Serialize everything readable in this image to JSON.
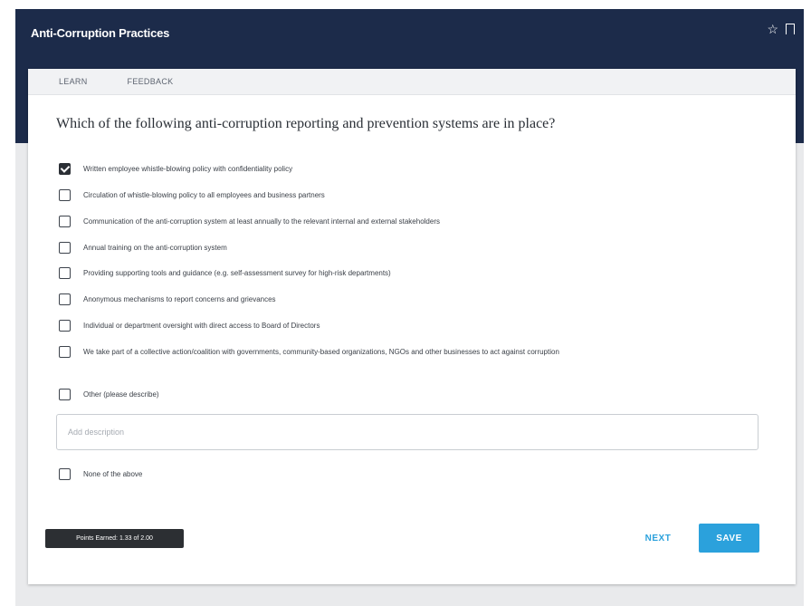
{
  "window": {
    "title": "Anti-Corruption Practices",
    "star_icon": "star-icon",
    "bookmark_icon": "bookmark-icon"
  },
  "tabs": [
    {
      "label": "LEARN"
    },
    {
      "label": "FEEDBACK"
    }
  ],
  "question": "Which of the following anti-corruption reporting and prevention systems are in place?",
  "options": [
    {
      "label": "Written employee whistle-blowing policy with confidentiality policy",
      "checked": true
    },
    {
      "label": "Circulation of whistle-blowing policy to all employees and business partners",
      "checked": false
    },
    {
      "label": "Communication of the anti-corruption system at least annually to the relevant internal and external stakeholders",
      "checked": false
    },
    {
      "label": "Annual training on the anti-corruption system",
      "checked": false
    },
    {
      "label": "Providing supporting tools and guidance (e.g. self-assessment survey for high-risk departments)",
      "checked": false
    },
    {
      "label": "Anonymous mechanisms to report concerns and grievances",
      "checked": false
    },
    {
      "label": "Individual or department oversight with direct access to Board of Directors",
      "checked": false
    },
    {
      "label": "We take part of a collective action/coalition with governments, community-based organizations, NGOs and other businesses to act against corruption",
      "checked": false
    },
    {
      "label": "Other (please describe)",
      "checked": false
    }
  ],
  "description": {
    "placeholder": "Add description",
    "value": ""
  },
  "none_option": {
    "label": "None of the above",
    "checked": false
  },
  "points_badge": "Points Earned: 1.33 of 2.00",
  "buttons": {
    "next": "NEXT",
    "save": "SAVE"
  },
  "colors": {
    "header": "#1c2b4a",
    "accent": "#2ba1dc",
    "badge": "#2c2f33"
  }
}
